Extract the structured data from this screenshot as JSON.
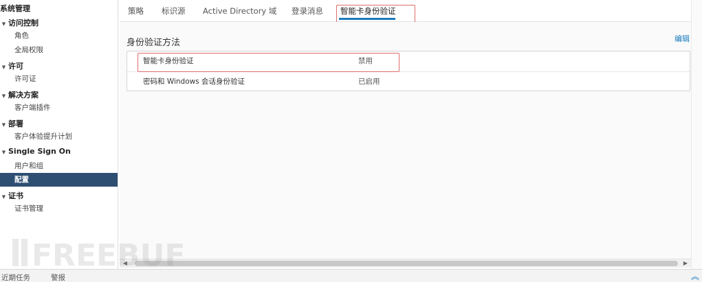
{
  "sidebar": {
    "section_title": "系统管理",
    "groups": [
      {
        "label": "访问控制",
        "items": [
          "角色",
          "全局权限"
        ]
      },
      {
        "label": "许可",
        "items": [
          "许可证"
        ]
      },
      {
        "label": "解决方案",
        "items": [
          "客户端插件"
        ]
      },
      {
        "label": "部署",
        "items": [
          "客户体验提升计划"
        ]
      },
      {
        "label": "Single Sign On",
        "items": [
          "用户和组",
          "配置"
        ]
      },
      {
        "label": "证书",
        "items": [
          "证书管理"
        ]
      }
    ],
    "active_item": "配置"
  },
  "tabs": [
    "策略",
    "标识源",
    "Active Directory 域",
    "登录消息",
    "智能卡身份验证"
  ],
  "active_tab": "智能卡身份验证",
  "main": {
    "section_title": "身份验证方法",
    "edit_label": "编辑",
    "rows": [
      {
        "name": "智能卡身份验证",
        "status": "禁用"
      },
      {
        "name": "密码和 Windows 会话身份验证",
        "status": "已启用"
      }
    ]
  },
  "bottombar": {
    "tabs": [
      "近期任务",
      "警报"
    ]
  },
  "watermark": "FREEBUF",
  "colors": {
    "accent": "#1a7bbd",
    "active_nav_bg": "#2e4f72",
    "highlight_box": "#e06b6b"
  }
}
